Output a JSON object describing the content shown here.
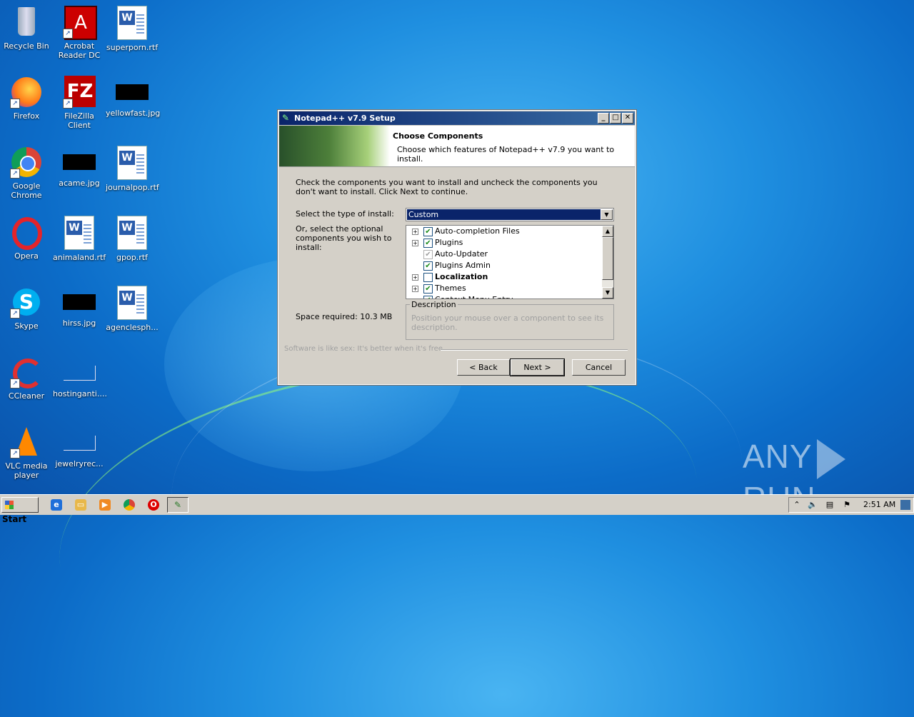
{
  "desktop": {
    "icons": [
      {
        "label": "Recycle Bin",
        "icon": "recycle-bin-icon"
      },
      {
        "label": "Acrobat Reader DC",
        "icon": "acrobat-icon"
      },
      {
        "label": "superporn.rtf",
        "icon": "word-document-icon"
      },
      {
        "label": "Firefox",
        "icon": "firefox-icon"
      },
      {
        "label": "FileZilla Client",
        "icon": "filezilla-icon"
      },
      {
        "label": "yellowfast.jpg",
        "icon": "image-thumbnail"
      },
      {
        "label": "Google Chrome",
        "icon": "chrome-icon"
      },
      {
        "label": "acame.jpg",
        "icon": "image-thumbnail"
      },
      {
        "label": "journalpop.rtf",
        "icon": "word-document-icon"
      },
      {
        "label": "Opera",
        "icon": "opera-icon"
      },
      {
        "label": "animaland.rtf",
        "icon": "word-document-icon"
      },
      {
        "label": "gpop.rtf",
        "icon": "word-document-icon"
      },
      {
        "label": "Skype",
        "icon": "skype-icon"
      },
      {
        "label": "hirss.jpg",
        "icon": "image-thumbnail"
      },
      {
        "label": "agenclesph...",
        "icon": "word-document-icon"
      },
      {
        "label": "CCleaner",
        "icon": "ccleaner-icon"
      },
      {
        "label": "hostinganti....",
        "icon": "blank-file-icon"
      },
      {
        "label": "VLC media player",
        "icon": "vlc-icon"
      },
      {
        "label": "jewelryrec...",
        "icon": "blank-file-icon"
      }
    ]
  },
  "dialog": {
    "title": "Notepad++ v7.9 Setup",
    "header_title": "Choose Components",
    "header_subtitle": "Choose which features of Notepad++ v7.9 you want to install.",
    "intro": "Check the components you want to install and uncheck the components you don't want to install. Click Next to continue.",
    "install_type_label": "Select the type of install:",
    "install_type_value": "Custom",
    "optional_label": "Or, select the optional components you wish to install:",
    "components": [
      {
        "label": "Auto-completion Files",
        "checked": true,
        "expandable": true,
        "bold": false,
        "disabled": false
      },
      {
        "label": "Plugins",
        "checked": true,
        "expandable": true,
        "bold": false,
        "disabled": false
      },
      {
        "label": "Auto-Updater",
        "checked": true,
        "expandable": false,
        "bold": false,
        "disabled": true
      },
      {
        "label": "Plugins Admin",
        "checked": true,
        "expandable": false,
        "bold": false,
        "disabled": false
      },
      {
        "label": "Localization",
        "checked": false,
        "expandable": true,
        "bold": true,
        "disabled": false
      },
      {
        "label": "Themes",
        "checked": true,
        "expandable": true,
        "bold": false,
        "disabled": false
      },
      {
        "label": "Context Menu Entry",
        "checked": true,
        "expandable": false,
        "bold": false,
        "disabled": false
      }
    ],
    "space_required": "Space required: 10.3 MB",
    "description_legend": "Description",
    "description_text": "Position your mouse over a component to see its description.",
    "branding": "Software is like sex: It's better when it's free",
    "buttons": {
      "back": "< Back",
      "next": "Next >",
      "cancel": "Cancel"
    }
  },
  "watermark": {
    "left": "ANY",
    "right": "RUN"
  },
  "taskbar": {
    "start_label": "Start",
    "clock": "2:51 AM"
  },
  "colors": {
    "title_bar": "#0a246a",
    "selection": "#0a246a",
    "desktop": "#1f8fe0"
  }
}
